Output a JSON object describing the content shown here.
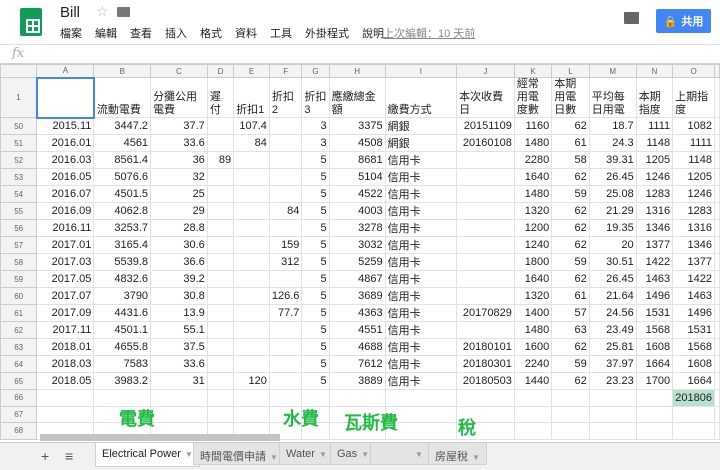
{
  "app": {
    "title": "Bill",
    "menu": [
      "檔案",
      "編輯",
      "查看",
      "插入",
      "格式",
      "資料",
      "工具",
      "外掛程式",
      "說明"
    ],
    "last_edit": "上次編輯：10 天前",
    "share_label": "共用",
    "fx_label": "fx"
  },
  "columns": [
    "A",
    "B",
    "C",
    "D",
    "E",
    "F",
    "G",
    "H",
    "I",
    "J",
    "K",
    "L",
    "M",
    "N",
    "O"
  ],
  "header_row": {
    "num": "1",
    "cells": [
      "",
      "流動電費",
      "分攤公用電費",
      "遲付",
      "折扣1",
      "折扣2",
      "折扣3",
      "應繳總金額",
      "繳費方式",
      "本次收費日",
      "經常用電度數",
      "本期用電日數",
      "平均每日用電",
      "本期指度",
      "上期指度"
    ]
  },
  "rows": [
    {
      "num": "50",
      "cells": [
        "2015.11",
        "3447.2",
        "37.7",
        "",
        "107.4",
        "",
        "3",
        "3375",
        "網銀",
        "20151109",
        "1160",
        "62",
        "18.7",
        "1111",
        "1082"
      ]
    },
    {
      "num": "51",
      "cells": [
        "2016.01",
        "4561",
        "33.6",
        "",
        "84",
        "",
        "3",
        "4508",
        "網銀",
        "20160108",
        "1480",
        "61",
        "24.3",
        "1148",
        "1111"
      ]
    },
    {
      "num": "52",
      "cells": [
        "2016.03",
        "8561.4",
        "36",
        "89",
        "",
        "",
        "5",
        "8681",
        "信用卡",
        "",
        "2280",
        "58",
        "39.31",
        "1205",
        "1148"
      ]
    },
    {
      "num": "53",
      "cells": [
        "2016.05",
        "5076.6",
        "32",
        "",
        "",
        "",
        "5",
        "5104",
        "信用卡",
        "",
        "1640",
        "62",
        "26.45",
        "1246",
        "1205"
      ]
    },
    {
      "num": "54",
      "cells": [
        "2016.07",
        "4501.5",
        "25",
        "",
        "",
        "",
        "5",
        "4522",
        "信用卡",
        "",
        "1480",
        "59",
        "25.08",
        "1283",
        "1246"
      ]
    },
    {
      "num": "55",
      "cells": [
        "2016.09",
        "4062.8",
        "29",
        "",
        "",
        "84",
        "5",
        "4003",
        "信用卡",
        "",
        "1320",
        "62",
        "21.29",
        "1316",
        "1283"
      ]
    },
    {
      "num": "56",
      "cells": [
        "2016.11",
        "3253.7",
        "28.8",
        "",
        "",
        "",
        "5",
        "3278",
        "信用卡",
        "",
        "1200",
        "62",
        "19.35",
        "1346",
        "1316"
      ]
    },
    {
      "num": "57",
      "cells": [
        "2017.01",
        "3165.4",
        "30.6",
        "",
        "",
        "159",
        "5",
        "3032",
        "信用卡",
        "",
        "1240",
        "62",
        "20",
        "1377",
        "1346"
      ]
    },
    {
      "num": "58",
      "cells": [
        "2017.03",
        "5539.8",
        "36.6",
        "",
        "",
        "312",
        "5",
        "5259",
        "信用卡",
        "",
        "1800",
        "59",
        "30.51",
        "1422",
        "1377"
      ]
    },
    {
      "num": "59",
      "cells": [
        "2017.05",
        "4832.6",
        "39.2",
        "",
        "",
        "",
        "5",
        "4867",
        "信用卡",
        "",
        "1640",
        "62",
        "26.45",
        "1463",
        "1422"
      ]
    },
    {
      "num": "60",
      "cells": [
        "2017.07",
        "3790",
        "30.8",
        "",
        "",
        "126.6",
        "5",
        "3689",
        "信用卡",
        "",
        "1320",
        "61",
        "21.64",
        "1496",
        "1463"
      ]
    },
    {
      "num": "61",
      "cells": [
        "2017.09",
        "4431.6",
        "13.9",
        "",
        "",
        "77.7",
        "5",
        "4363",
        "信用卡",
        "20170829",
        "1400",
        "57",
        "24.56",
        "1531",
        "1496"
      ]
    },
    {
      "num": "62",
      "cells": [
        "2017.11",
        "4501.1",
        "55.1",
        "",
        "",
        "",
        "5",
        "4551",
        "信用卡",
        "",
        "1480",
        "63",
        "23.49",
        "1568",
        "1531"
      ]
    },
    {
      "num": "63",
      "cells": [
        "2018.01",
        "4655.8",
        "37.5",
        "",
        "",
        "",
        "5",
        "4688",
        "信用卡",
        "20180101",
        "1600",
        "62",
        "25.81",
        "1608",
        "1568"
      ]
    },
    {
      "num": "64",
      "cells": [
        "2018.03",
        "7583",
        "33.6",
        "",
        "",
        "",
        "5",
        "7612",
        "信用卡",
        "20180301",
        "2240",
        "59",
        "37.97",
        "1664",
        "1608"
      ]
    },
    {
      "num": "65",
      "cells": [
        "2018.05",
        "3983.2",
        "31",
        "",
        "120",
        "",
        "5",
        "3889",
        "信用卡",
        "20180503",
        "1440",
        "62",
        "23.23",
        "1700",
        "1664"
      ]
    },
    {
      "num": "66",
      "cells": [
        "",
        "",
        "",
        "",
        "",
        "",
        "",
        "",
        "",
        "",
        "",
        "",
        "",
        "",
        "201806"
      ]
    },
    {
      "num": "67",
      "cells": [
        "",
        "",
        "",
        "",
        "",
        "",
        "",
        "",
        "",
        "",
        "",
        "",
        "",
        "",
        ""
      ]
    },
    {
      "num": "68",
      "cells": [
        "",
        "",
        "",
        "",
        "",
        "",
        "",
        "",
        "",
        "",
        "",
        "",
        "",
        "",
        ""
      ]
    }
  ],
  "annotations": [
    "電費",
    "水費",
    "瓦斯費",
    "稅"
  ],
  "sheet_tabs": [
    {
      "label": "Electrical Power",
      "active": true
    },
    {
      "label": "時間電價申請"
    },
    {
      "label": "Water"
    },
    {
      "label": "Gas"
    },
    {
      "label": ""
    },
    {
      "label": "房屋稅"
    }
  ],
  "colors": {
    "annotation": "#22bb44",
    "share": "#4285f4",
    "highlight": "#b7e1cd"
  }
}
